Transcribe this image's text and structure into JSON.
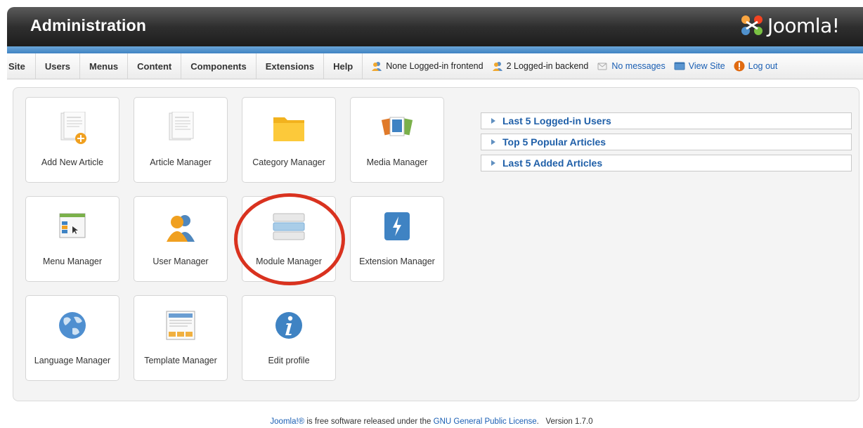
{
  "header": {
    "title": "Administration",
    "logo_text": "Joomla!",
    "logo_icon": "joomla-logo-icon"
  },
  "menu": {
    "items": [
      "Site",
      "Users",
      "Menus",
      "Content",
      "Components",
      "Extensions",
      "Help"
    ]
  },
  "status": {
    "frontend": "None Logged-in frontend",
    "backend": "2 Logged-in backend",
    "messages": "No messages",
    "view_site": "View Site",
    "logout": "Log out"
  },
  "tiles": [
    {
      "label": "Add New Article",
      "icon": "add-article-icon"
    },
    {
      "label": "Article Manager",
      "icon": "article-icon"
    },
    {
      "label": "Category Manager",
      "icon": "folder-icon"
    },
    {
      "label": "Media Manager",
      "icon": "media-icon"
    },
    {
      "label": "Menu Manager",
      "icon": "menu-icon"
    },
    {
      "label": "User Manager",
      "icon": "user-icon"
    },
    {
      "label": "Module Manager",
      "icon": "module-icon"
    },
    {
      "label": "Extension Manager",
      "icon": "extension-icon"
    },
    {
      "label": "Language Manager",
      "icon": "globe-icon"
    },
    {
      "label": "Template Manager",
      "icon": "template-icon"
    },
    {
      "label": "Edit profile",
      "icon": "info-icon"
    }
  ],
  "sliders": [
    "Last 5 Logged-in Users",
    "Top 5 Popular Articles",
    "Last 5 Added Articles"
  ],
  "footer": {
    "brand": "Joomla!®",
    "text_mid": " is free software released under the ",
    "license": "GNU General Public License",
    "text_end": ".",
    "version": "Version 1.7.0"
  },
  "colors": {
    "accent": "#3f83c3",
    "link": "#1a5fb4",
    "highlight_ring": "#d9321f"
  }
}
